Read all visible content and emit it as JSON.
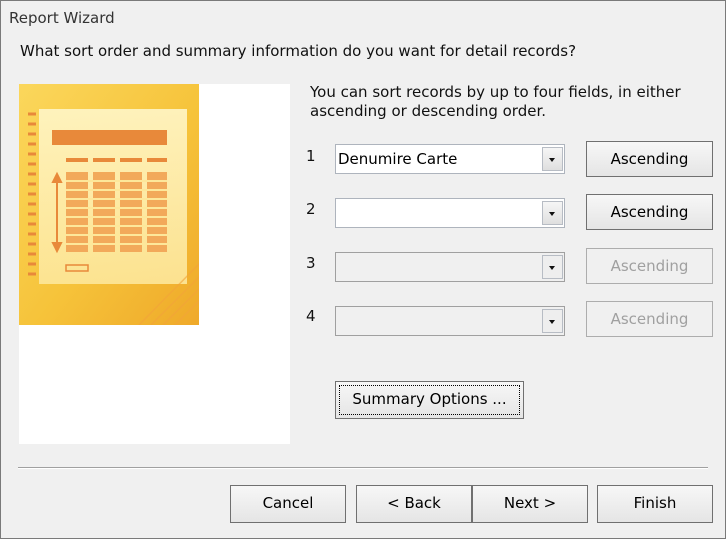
{
  "window": {
    "title": "Report Wizard"
  },
  "question": "What sort order and summary information do you want for detail records?",
  "info": "You can sort records by up to four fields, in either ascending or descending order.",
  "sort_rows": [
    {
      "number": "1",
      "field_value": "Denumire Carte",
      "order_label": "Ascending",
      "enabled": true
    },
    {
      "number": "2",
      "field_value": "",
      "order_label": "Ascending",
      "enabled": true
    },
    {
      "number": "3",
      "field_value": "",
      "order_label": "Ascending",
      "enabled": false
    },
    {
      "number": "4",
      "field_value": "",
      "order_label": "Ascending",
      "enabled": false
    }
  ],
  "summary_button": {
    "label": "Summary Options ..."
  },
  "footer": {
    "cancel": "Cancel",
    "back": "< Back",
    "next": "Next >",
    "finish": "Finish"
  },
  "icons": {
    "preview": "report-preview-icon",
    "dropdown": "chevron-down-icon"
  },
  "colors": {
    "window_bg": "#f0f0f0",
    "panel_bg": "#ffffff",
    "preview_yellow": "#f6c33a",
    "preview_orange": "#e8893a",
    "disabled_text": "#a0a0a0"
  }
}
